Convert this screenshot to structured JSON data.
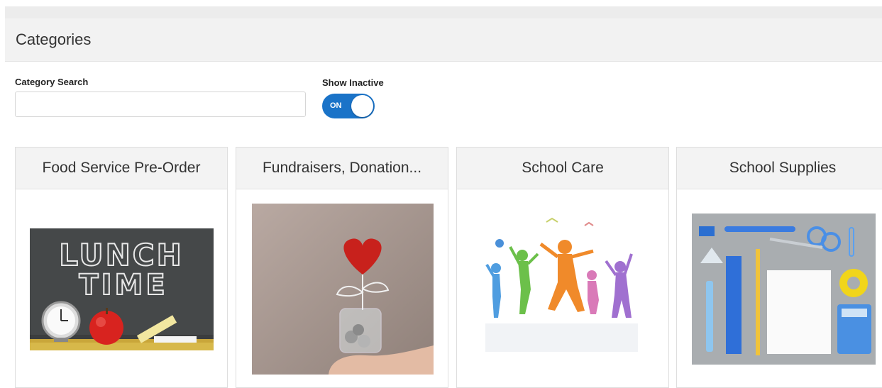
{
  "page": {
    "title": "Categories"
  },
  "filters": {
    "search_label": "Category Search",
    "search_value": "",
    "search_placeholder": "",
    "inactive_label": "Show Inactive",
    "toggle_state": "ON"
  },
  "categories": [
    {
      "title": "Food Service Pre-Order",
      "image": "lunch-time-chalkboard",
      "image_text_line1": "LUNCH",
      "image_text_line2": "TIME"
    },
    {
      "title": "Fundraisers, Donation...",
      "image": "heart-coins-jar"
    },
    {
      "title": "School Care",
      "image": "children-silhouettes"
    },
    {
      "title": "School Supplies",
      "image": "school-supplies-flatlay"
    }
  ],
  "colors": {
    "accent": "#1a73c8",
    "header_bg": "#f2f2f2",
    "card_title_bg": "#f3f3f3"
  }
}
